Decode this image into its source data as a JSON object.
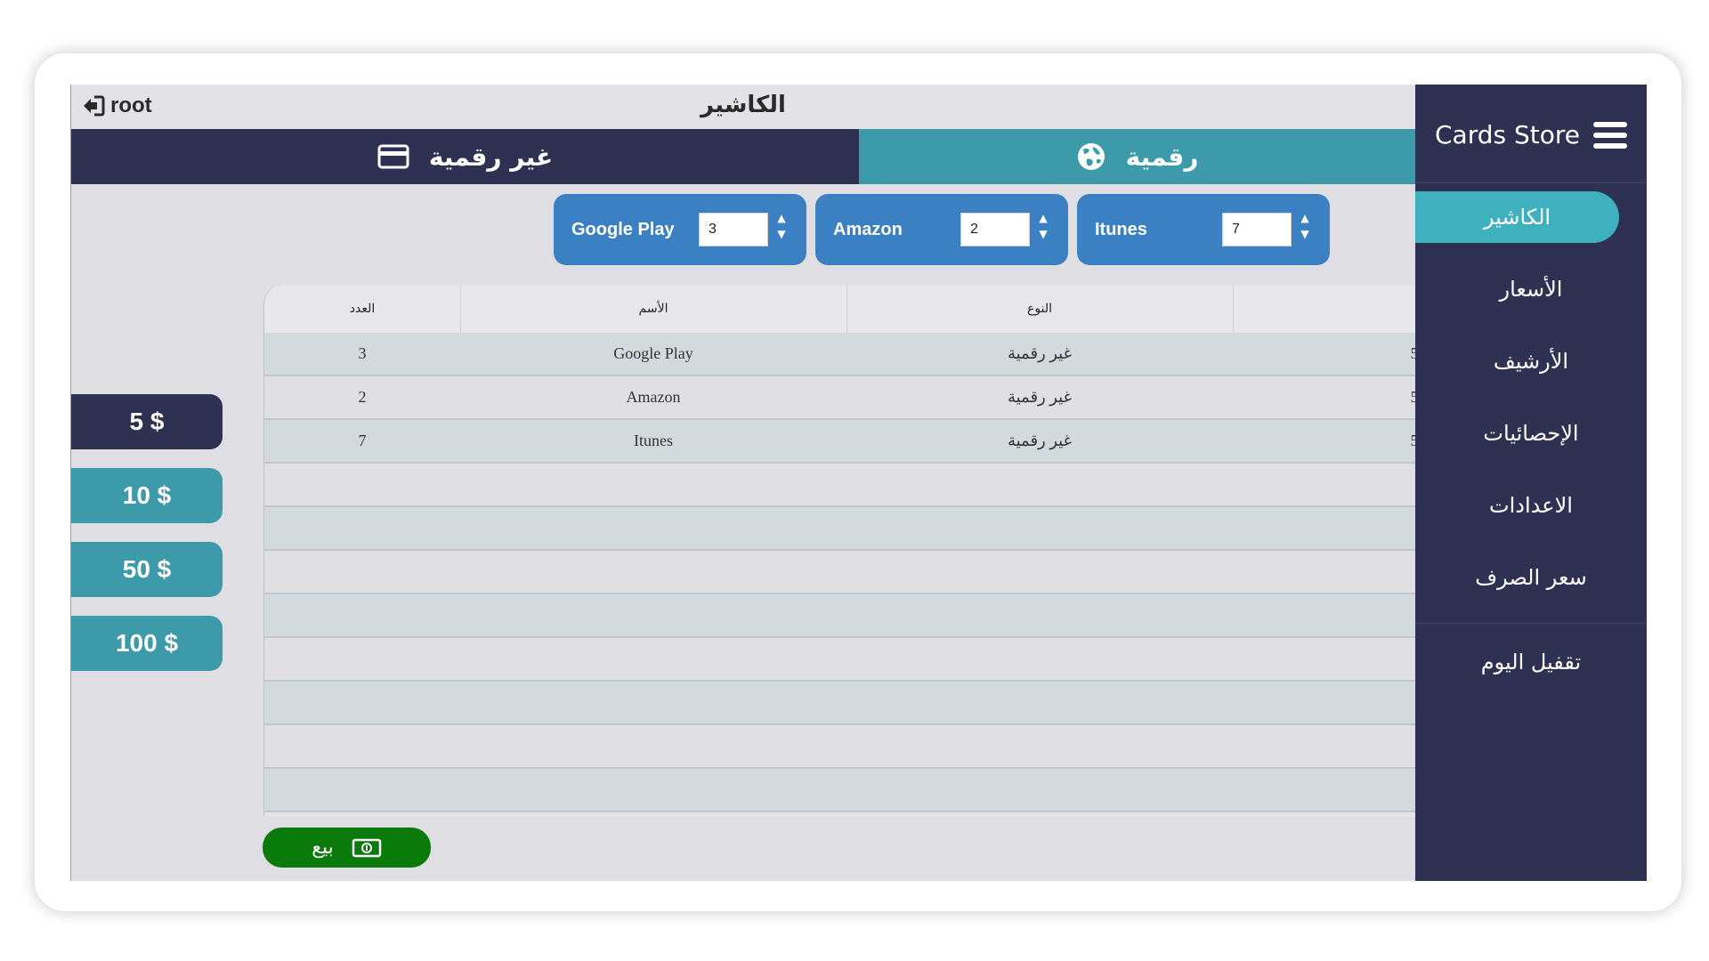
{
  "header": {
    "user": "root",
    "title": "الكاشير"
  },
  "tabs": {
    "non_digital": "غير رقمية",
    "digital": "رقمية"
  },
  "products": [
    {
      "label": "Google Play",
      "quantity": "3"
    },
    {
      "label": "Amazon",
      "quantity": "2"
    },
    {
      "label": "Itunes",
      "quantity": "7"
    }
  ],
  "table": {
    "columns": {
      "count": "العدد",
      "name": "الأسم",
      "type": "النوع"
    },
    "rows": [
      {
        "count": "3",
        "name": "Google Play",
        "type": "غير رقمية",
        "extra": "5"
      },
      {
        "count": "2",
        "name": "Amazon",
        "type": "غير رقمية",
        "extra": "5"
      },
      {
        "count": "7",
        "name": "Itunes",
        "type": "غير رقمية",
        "extra": "5"
      }
    ]
  },
  "denominations": [
    "5 $",
    "10 $",
    "50 $",
    "100 $"
  ],
  "sell_label": "بيع",
  "sidebar": {
    "brand": "Cards Store",
    "items": [
      "الكاشير",
      "الأسعار",
      "الأرشيف",
      "الإحصائيات",
      "الاعدادات",
      "سعر الصرف"
    ],
    "bottom_item": "تقفيل اليوم"
  },
  "colors": {
    "sidebar": "#2e3152",
    "accent": "#3fb0bd",
    "chip": "#3b80c2",
    "sell": "#0a7a0a"
  }
}
